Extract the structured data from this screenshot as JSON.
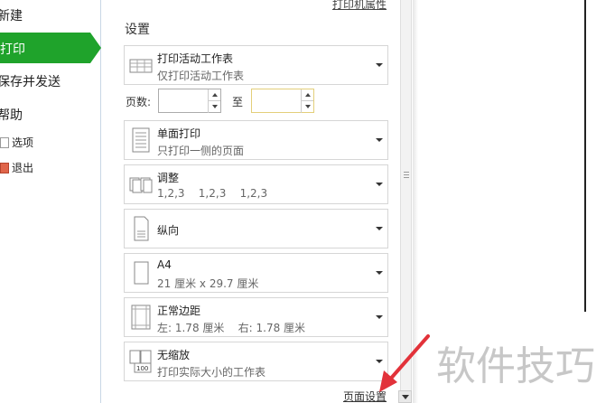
{
  "nav": {
    "new_label": "新建",
    "print_label": "打印",
    "save_send_label": "保存并发送",
    "help_label": "帮助",
    "options_label": "选项",
    "exit_label": "退出"
  },
  "settings": {
    "printer_properties_link": "打印机属性",
    "section_title": "设置",
    "print_what": {
      "title": "打印活动工作表",
      "subtitle": "仅打印活动工作表"
    },
    "pages": {
      "label": "页数:",
      "from_value": "",
      "to_label": "至",
      "to_value": ""
    },
    "sides": {
      "title": "单面打印",
      "subtitle": "只打印一侧的页面"
    },
    "collate": {
      "title": "调整",
      "subtitle": "1,2,3    1,2,3    1,2,3"
    },
    "orientation": {
      "title": "纵向"
    },
    "paper_size": {
      "title": "A4",
      "subtitle": "21 厘米 x 29.7 厘米"
    },
    "margins": {
      "title": "正常边距",
      "subtitle": "左: 1.78 厘米    右: 1.78 厘米"
    },
    "scaling": {
      "title": "无缩放",
      "subtitle": "打印实际大小的工作表"
    },
    "page_setup_link": "页面设置"
  },
  "watermark": "软件技巧",
  "colors": {
    "accent_green": "#1fa32b",
    "annotation_red": "#e2323a"
  }
}
